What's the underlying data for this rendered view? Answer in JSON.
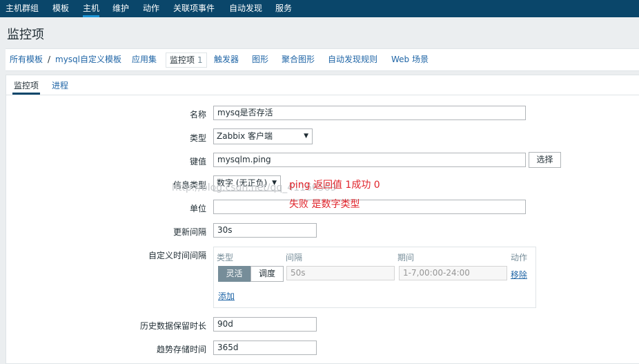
{
  "topnav": {
    "items": [
      {
        "label": "主机群组"
      },
      {
        "label": "模板"
      },
      {
        "label": "主机",
        "active": true
      },
      {
        "label": "维护"
      },
      {
        "label": "动作"
      },
      {
        "label": "关联项事件"
      },
      {
        "label": "自动发现"
      },
      {
        "label": "服务"
      }
    ]
  },
  "page": {
    "title": "监控项"
  },
  "breadcrumb": {
    "all_templates": "所有模板",
    "separator": "/",
    "template": "mysql自定义模板",
    "applications": "应用集",
    "items": "监控项",
    "items_count": "1",
    "triggers": "触发器",
    "graphs": "图形",
    "screens": "聚合图形",
    "discovery": "自动发现规则",
    "web": "Web 场景"
  },
  "tabs": [
    {
      "label": "监控项",
      "active": true
    },
    {
      "label": "进程"
    }
  ],
  "form": {
    "name": {
      "label": "名称",
      "value": "mysq是否存活"
    },
    "type": {
      "label": "类型",
      "value": "Zabbix 客户端"
    },
    "key": {
      "label": "键值",
      "value": "mysqlm.ping",
      "button": "选择"
    },
    "info_type": {
      "label": "信息类型",
      "value": "数字 (无正负)"
    },
    "units": {
      "label": "单位",
      "value": ""
    },
    "interval": {
      "label": "更新间隔",
      "value": "30s"
    },
    "custom_intervals": {
      "label": "自定义时间间隔",
      "headers": {
        "type": "类型",
        "interval": "间隔",
        "period": "期间",
        "action": "动作"
      },
      "row": {
        "flexible": "灵活",
        "scheduling": "调度",
        "interval_placeholder": "50s",
        "period_placeholder": "1-7,00:00-24:00",
        "remove": "移除"
      },
      "add": "添加"
    },
    "history": {
      "label": "历史数据保留时长",
      "value": "90d"
    },
    "trends": {
      "label": "趋势存储时间",
      "value": "365d"
    }
  },
  "annotation": {
    "line1": "ping 返回值 1成功 0",
    "line2": "失败  是数字类型"
  },
  "watermark": "http://blog.csdn.net/qq_41166569",
  "colors": {
    "topnav_bg": "#0a466a",
    "link": "#1f65a6",
    "annotation": "#e0242b",
    "segment_active": "#768d99"
  }
}
